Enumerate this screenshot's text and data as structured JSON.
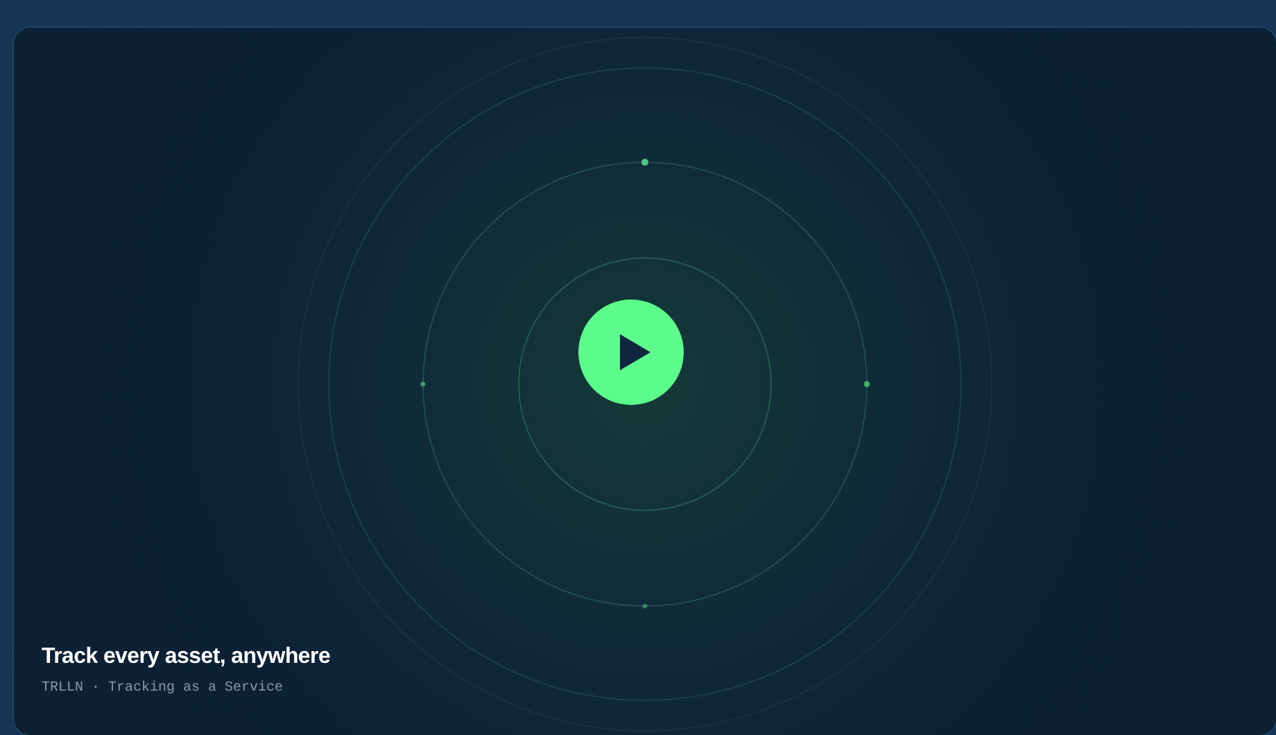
{
  "video": {
    "playing": false,
    "title": "Track every asset, anywhere",
    "subtitle": "TRLLN · Tracking as a Service"
  }
}
